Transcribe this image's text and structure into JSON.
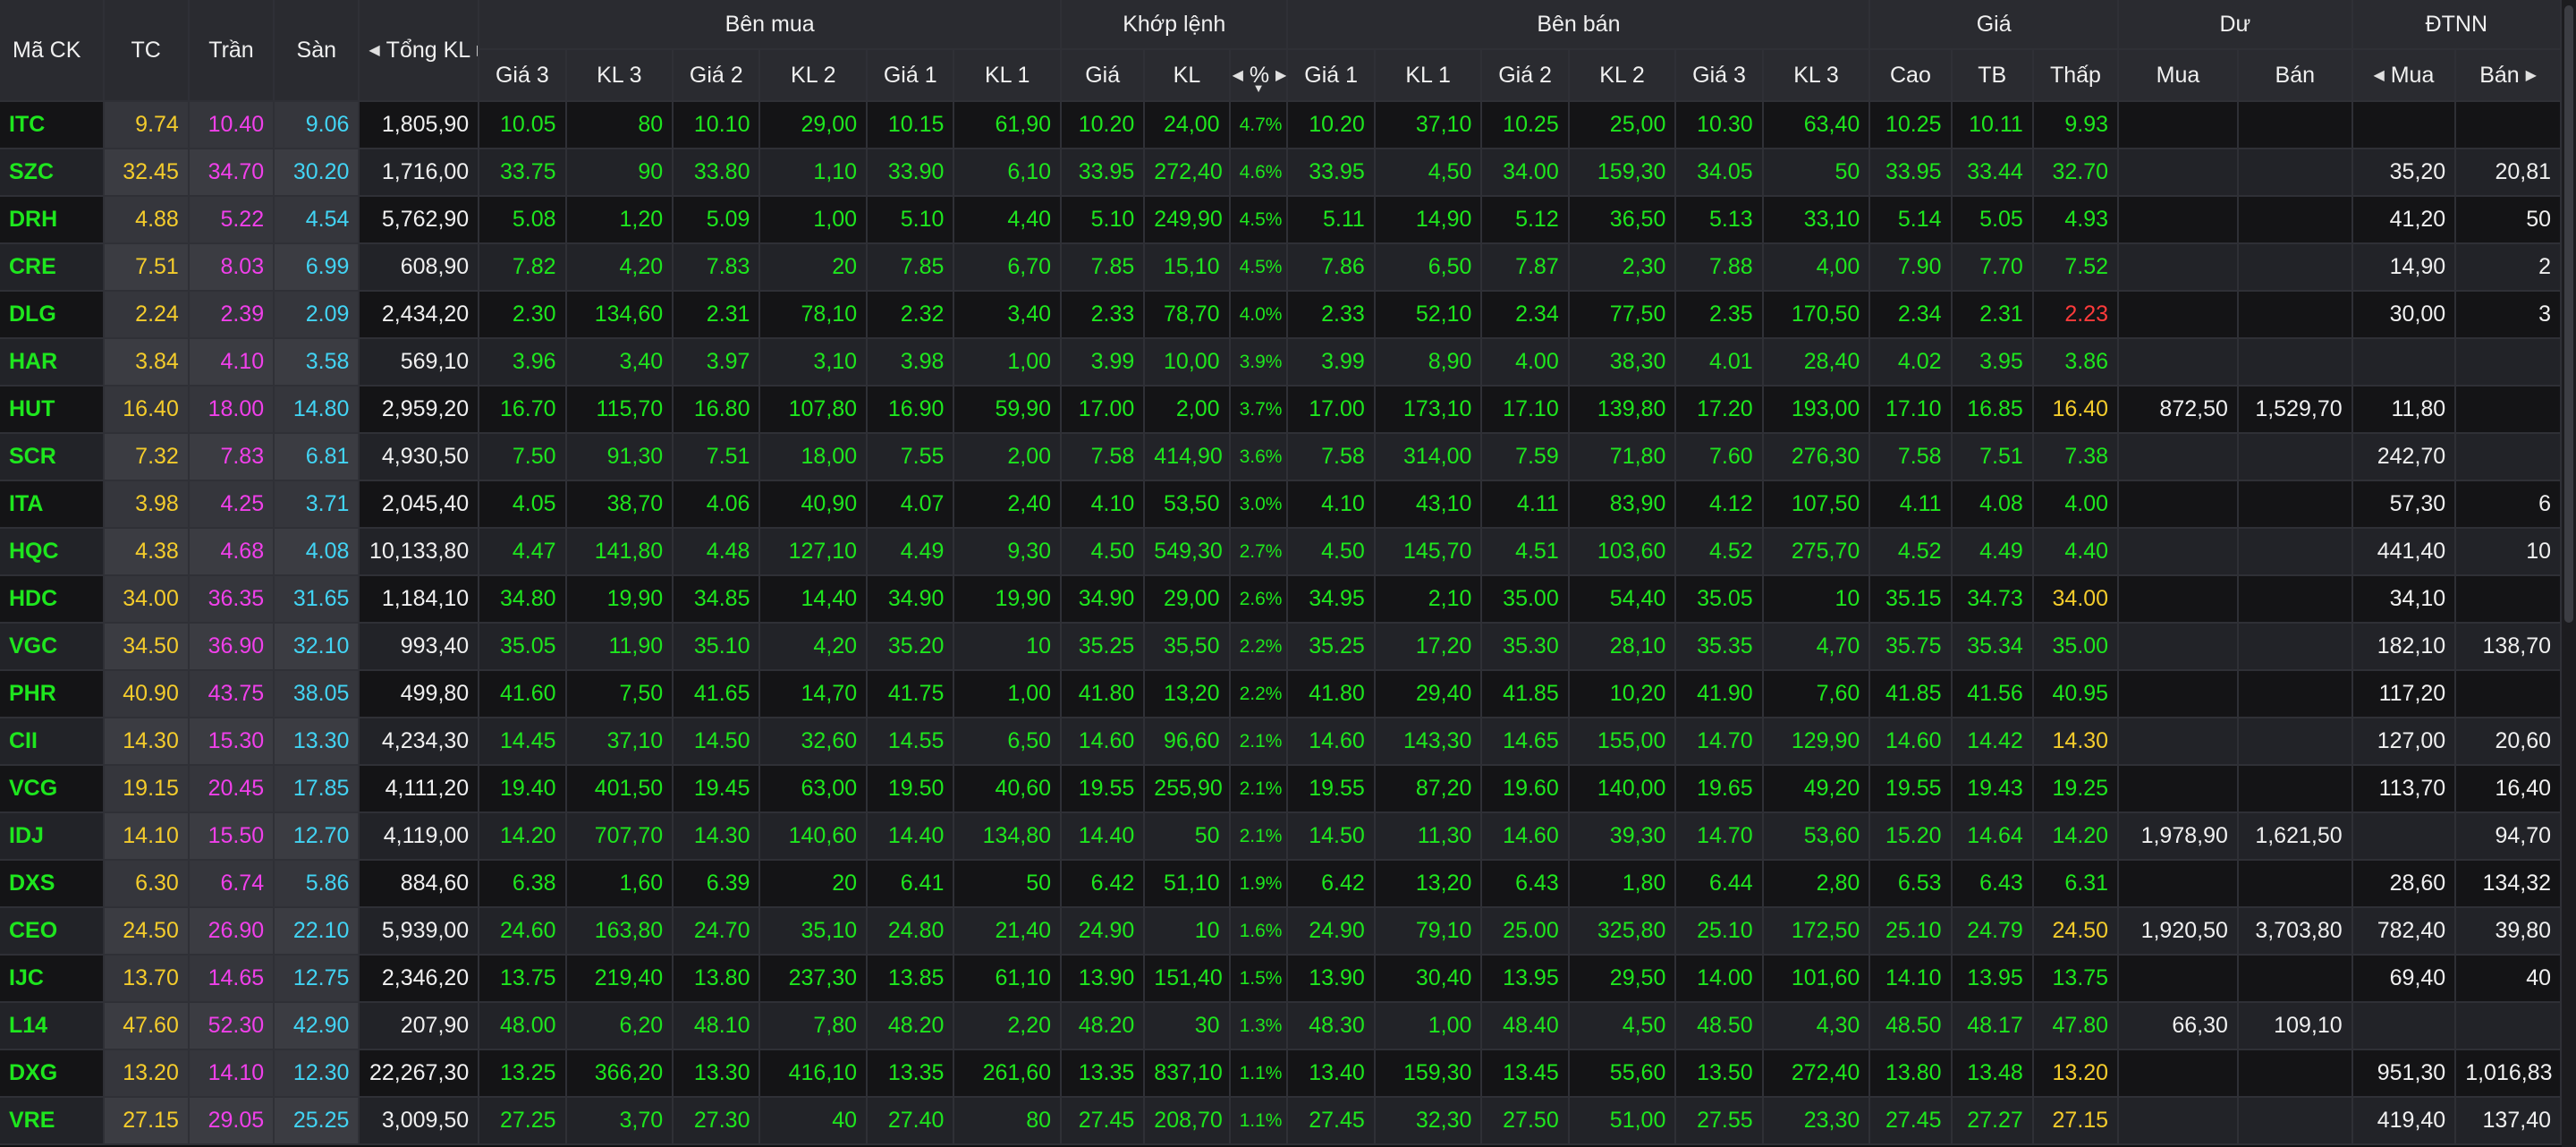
{
  "headers": {
    "stock": "Mã CK",
    "tc": "TC",
    "tran": "Trần",
    "san": "Sàn",
    "tongkl": "Tổng KL",
    "buy_group": "Bên mua",
    "match_group": "Khớp lệnh",
    "sell_group": "Bên bán",
    "price_group": "Giá",
    "residual_group": "Dư",
    "foreign_group": "ĐTNN",
    "gia3": "Giá 3",
    "kl3": "KL 3",
    "gia2": "Giá 2",
    "kl2": "KL 2",
    "gia1": "Giá 1",
    "kl1": "KL 1",
    "m_gia": "Giá",
    "m_kl": "KL",
    "m_pct": "%",
    "cao": "Cao",
    "tb": "TB",
    "thap": "Thấp",
    "du_mua": "Mua",
    "du_ban": "Bán",
    "f_mua": "Mua",
    "f_ban": "Bán"
  },
  "icons": {
    "arrow_left": "◀",
    "arrow_right": "▶",
    "sort_down": "▼"
  },
  "colors": {
    "up": "#1ee61e",
    "ref": "#f4cc2c",
    "ceiling": "#f040ea",
    "floor": "#42d4f4",
    "down": "#ff3b3b"
  },
  "columns": [
    "sym",
    "tc",
    "tran",
    "san",
    "tongkl",
    "b3p",
    "b3v",
    "b2p",
    "b2v",
    "b1p",
    "b1v",
    "mp",
    "mv",
    "pct",
    "s1p",
    "s1v",
    "s2p",
    "s2v",
    "s3p",
    "s3v",
    "cao",
    "tb",
    "thap",
    "dumua",
    "duban",
    "fmua",
    "fban"
  ],
  "rows": [
    [
      "ITC",
      "9.74",
      "10.40",
      "9.06",
      "1,805,90",
      "10.05",
      "80",
      "10.10",
      "29,00",
      "10.15",
      "61,90",
      "10.20",
      "24,00",
      "4.7%",
      "10.20",
      "37,10",
      "10.25",
      "25,00",
      "10.30",
      "63,40",
      "10.25",
      "10.11",
      "9.93",
      "",
      "",
      "",
      ""
    ],
    [
      "SZC",
      "32.45",
      "34.70",
      "30.20",
      "1,716,00",
      "33.75",
      "90",
      "33.80",
      "1,10",
      "33.90",
      "6,10",
      "33.95",
      "272,40",
      "4.6%",
      "33.95",
      "4,50",
      "34.00",
      "159,30",
      "34.05",
      "50",
      "33.95",
      "33.44",
      "32.70",
      "",
      "",
      "35,20",
      "20,81"
    ],
    [
      "DRH",
      "4.88",
      "5.22",
      "4.54",
      "5,762,90",
      "5.08",
      "1,20",
      "5.09",
      "1,00",
      "5.10",
      "4,40",
      "5.10",
      "249,90",
      "4.5%",
      "5.11",
      "14,90",
      "5.12",
      "36,50",
      "5.13",
      "33,10",
      "5.14",
      "5.05",
      "4.93",
      "",
      "",
      "41,20",
      "50"
    ],
    [
      "CRE",
      "7.51",
      "8.03",
      "6.99",
      "608,90",
      "7.82",
      "4,20",
      "7.83",
      "20",
      "7.85",
      "6,70",
      "7.85",
      "15,10",
      "4.5%",
      "7.86",
      "6,50",
      "7.87",
      "2,30",
      "7.88",
      "4,00",
      "7.90",
      "7.70",
      "7.52",
      "",
      "",
      "14,90",
      "2"
    ],
    [
      "DLG",
      "2.24",
      "2.39",
      "2.09",
      "2,434,20",
      "2.30",
      "134,60",
      "2.31",
      "78,10",
      "2.32",
      "3,40",
      "2.33",
      "78,70",
      "4.0%",
      "2.33",
      "52,10",
      "2.34",
      "77,50",
      "2.35",
      "170,50",
      "2.34",
      "2.31",
      "2.23",
      "",
      "",
      "30,00",
      "3"
    ],
    [
      "HAR",
      "3.84",
      "4.10",
      "3.58",
      "569,10",
      "3.96",
      "3,40",
      "3.97",
      "3,10",
      "3.98",
      "1,00",
      "3.99",
      "10,00",
      "3.9%",
      "3.99",
      "8,90",
      "4.00",
      "38,30",
      "4.01",
      "28,40",
      "4.02",
      "3.95",
      "3.86",
      "",
      "",
      "",
      ""
    ],
    [
      "HUT",
      "16.40",
      "18.00",
      "14.80",
      "2,959,20",
      "16.70",
      "115,70",
      "16.80",
      "107,80",
      "16.90",
      "59,90",
      "17.00",
      "2,00",
      "3.7%",
      "17.00",
      "173,10",
      "17.10",
      "139,80",
      "17.20",
      "193,00",
      "17.10",
      "16.85",
      "16.40",
      "872,50",
      "1,529,70",
      "11,80",
      ""
    ],
    [
      "SCR",
      "7.32",
      "7.83",
      "6.81",
      "4,930,50",
      "7.50",
      "91,30",
      "7.51",
      "18,00",
      "7.55",
      "2,00",
      "7.58",
      "414,90",
      "3.6%",
      "7.58",
      "314,00",
      "7.59",
      "71,80",
      "7.60",
      "276,30",
      "7.58",
      "7.51",
      "7.38",
      "",
      "",
      "242,70",
      ""
    ],
    [
      "ITA",
      "3.98",
      "4.25",
      "3.71",
      "2,045,40",
      "4.05",
      "38,70",
      "4.06",
      "40,90",
      "4.07",
      "2,40",
      "4.10",
      "53,50",
      "3.0%",
      "4.10",
      "43,10",
      "4.11",
      "83,90",
      "4.12",
      "107,50",
      "4.11",
      "4.08",
      "4.00",
      "",
      "",
      "57,30",
      "6"
    ],
    [
      "HQC",
      "4.38",
      "4.68",
      "4.08",
      "10,133,80",
      "4.47",
      "141,80",
      "4.48",
      "127,10",
      "4.49",
      "9,30",
      "4.50",
      "549,30",
      "2.7%",
      "4.50",
      "145,70",
      "4.51",
      "103,60",
      "4.52",
      "275,70",
      "4.52",
      "4.49",
      "4.40",
      "",
      "",
      "441,40",
      "10"
    ],
    [
      "HDC",
      "34.00",
      "36.35",
      "31.65",
      "1,184,10",
      "34.80",
      "19,90",
      "34.85",
      "14,40",
      "34.90",
      "19,90",
      "34.90",
      "29,00",
      "2.6%",
      "34.95",
      "2,10",
      "35.00",
      "54,40",
      "35.05",
      "10",
      "35.15",
      "34.73",
      "34.00",
      "",
      "",
      "34,10",
      ""
    ],
    [
      "VGC",
      "34.50",
      "36.90",
      "32.10",
      "993,40",
      "35.05",
      "11,90",
      "35.10",
      "4,20",
      "35.20",
      "10",
      "35.25",
      "35,50",
      "2.2%",
      "35.25",
      "17,20",
      "35.30",
      "28,10",
      "35.35",
      "4,70",
      "35.75",
      "35.34",
      "35.00",
      "",
      "",
      "182,10",
      "138,70"
    ],
    [
      "PHR",
      "40.90",
      "43.75",
      "38.05",
      "499,80",
      "41.60",
      "7,50",
      "41.65",
      "14,70",
      "41.75",
      "1,00",
      "41.80",
      "13,20",
      "2.2%",
      "41.80",
      "29,40",
      "41.85",
      "10,20",
      "41.90",
      "7,60",
      "41.85",
      "41.56",
      "40.95",
      "",
      "",
      "117,20",
      ""
    ],
    [
      "CII",
      "14.30",
      "15.30",
      "13.30",
      "4,234,30",
      "14.45",
      "37,10",
      "14.50",
      "32,60",
      "14.55",
      "6,50",
      "14.60",
      "96,60",
      "2.1%",
      "14.60",
      "143,30",
      "14.65",
      "155,00",
      "14.70",
      "129,90",
      "14.60",
      "14.42",
      "14.30",
      "",
      "",
      "127,00",
      "20,60"
    ],
    [
      "VCG",
      "19.15",
      "20.45",
      "17.85",
      "4,111,20",
      "19.40",
      "401,50",
      "19.45",
      "63,00",
      "19.50",
      "40,60",
      "19.55",
      "255,90",
      "2.1%",
      "19.55",
      "87,20",
      "19.60",
      "140,00",
      "19.65",
      "49,20",
      "19.55",
      "19.43",
      "19.25",
      "",
      "",
      "113,70",
      "16,40"
    ],
    [
      "IDJ",
      "14.10",
      "15.50",
      "12.70",
      "4,119,00",
      "14.20",
      "707,70",
      "14.30",
      "140,60",
      "14.40",
      "134,80",
      "14.40",
      "50",
      "2.1%",
      "14.50",
      "11,30",
      "14.60",
      "39,30",
      "14.70",
      "53,60",
      "15.20",
      "14.64",
      "14.20",
      "1,978,90",
      "1,621,50",
      "",
      "94,70"
    ],
    [
      "DXS",
      "6.30",
      "6.74",
      "5.86",
      "884,60",
      "6.38",
      "1,60",
      "6.39",
      "20",
      "6.41",
      "50",
      "6.42",
      "51,10",
      "1.9%",
      "6.42",
      "13,20",
      "6.43",
      "1,80",
      "6.44",
      "2,80",
      "6.53",
      "6.43",
      "6.31",
      "",
      "",
      "28,60",
      "134,32"
    ],
    [
      "CEO",
      "24.50",
      "26.90",
      "22.10",
      "5,939,00",
      "24.60",
      "163,80",
      "24.70",
      "35,10",
      "24.80",
      "21,40",
      "24.90",
      "10",
      "1.6%",
      "24.90",
      "79,10",
      "25.00",
      "325,80",
      "25.10",
      "172,50",
      "25.10",
      "24.79",
      "24.50",
      "1,920,50",
      "3,703,80",
      "782,40",
      "39,80"
    ],
    [
      "IJC",
      "13.70",
      "14.65",
      "12.75",
      "2,346,20",
      "13.75",
      "219,40",
      "13.80",
      "237,30",
      "13.85",
      "61,10",
      "13.90",
      "151,40",
      "1.5%",
      "13.90",
      "30,40",
      "13.95",
      "29,50",
      "14.00",
      "101,60",
      "14.10",
      "13.95",
      "13.75",
      "",
      "",
      "69,40",
      "40"
    ],
    [
      "L14",
      "47.60",
      "52.30",
      "42.90",
      "207,90",
      "48.00",
      "6,20",
      "48.10",
      "7,80",
      "48.20",
      "2,20",
      "48.20",
      "30",
      "1.3%",
      "48.30",
      "1,00",
      "48.40",
      "4,50",
      "48.50",
      "4,30",
      "48.50",
      "48.17",
      "47.80",
      "66,30",
      "109,10",
      "",
      ""
    ],
    [
      "DXG",
      "13.20",
      "14.10",
      "12.30",
      "22,267,30",
      "13.25",
      "366,20",
      "13.30",
      "416,10",
      "13.35",
      "261,60",
      "13.35",
      "837,10",
      "1.1%",
      "13.40",
      "159,30",
      "13.45",
      "55,60",
      "13.50",
      "272,40",
      "13.80",
      "13.48",
      "13.20",
      "",
      "",
      "951,30",
      "1,016,83"
    ],
    [
      "VRE",
      "27.15",
      "29.05",
      "25.25",
      "3,009,50",
      "27.25",
      "3,70",
      "27.30",
      "40",
      "27.40",
      "80",
      "27.45",
      "208,70",
      "1.1%",
      "27.45",
      "32,30",
      "27.50",
      "51,00",
      "27.55",
      "23,30",
      "27.45",
      "27.27",
      "27.15",
      "",
      "",
      "419,40",
      "137,40"
    ]
  ],
  "cell_colors": {
    "note": "",
    "sym": "up",
    "tc": "ref",
    "tran": "ceiling",
    "san": "floor",
    "tongkl": "white",
    "fixed_white": [
      "dumua",
      "duban",
      "fmua",
      "fban"
    ]
  },
  "thap_colors": [
    "up",
    "up",
    "up",
    "up",
    "down",
    "up",
    "ref",
    "up",
    "up",
    "up",
    "ref",
    "up",
    "up",
    "ref",
    "up",
    "up",
    "up",
    "ref",
    "up",
    "up",
    "ref",
    "ref"
  ],
  "cao_colors": [
    "up",
    "up",
    "up",
    "up",
    "up",
    "up",
    "up",
    "up",
    "up",
    "up",
    "up",
    "up",
    "up",
    "up",
    "up",
    "up",
    "up",
    "up",
    "up",
    "up",
    "up",
    "up"
  ]
}
